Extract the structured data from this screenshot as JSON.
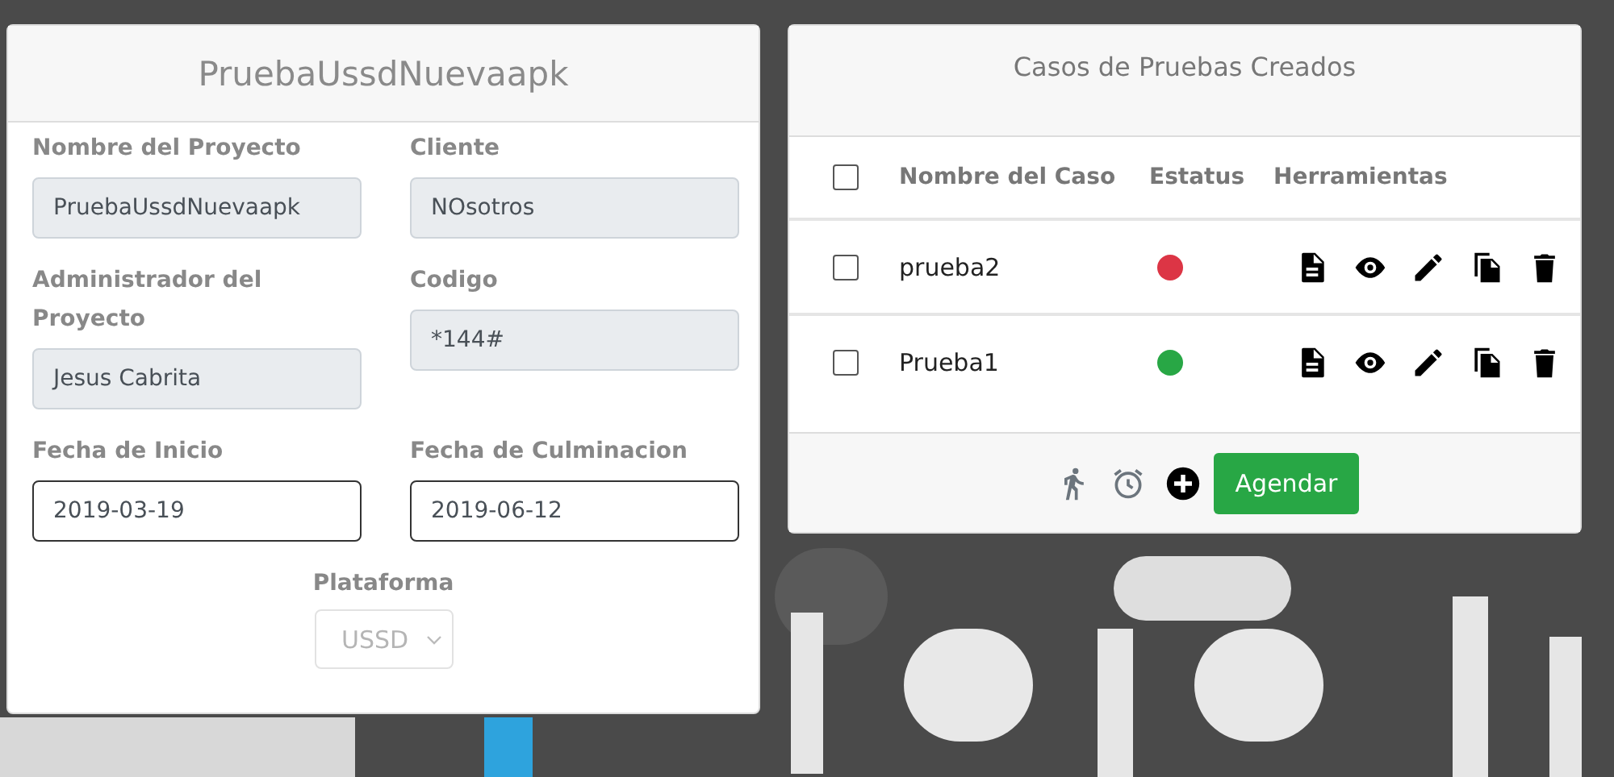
{
  "project_card": {
    "title": "PruebaUssdNuevaapk",
    "fields": [
      {
        "label": "Nombre del Proyecto",
        "value": "PruebaUssdNuevaapk",
        "readonly": true
      },
      {
        "label": "Cliente",
        "value": "NOsotros",
        "readonly": true
      },
      {
        "label": "Administrador del Proyecto",
        "value": "Jesus Cabrita",
        "readonly": true
      },
      {
        "label": "Codigo",
        "value": "*144#",
        "readonly": true
      },
      {
        "label": "Fecha de Inicio",
        "value": "2019-03-19",
        "readonly": false
      },
      {
        "label": "Fecha de Culminacion",
        "value": "2019-06-12",
        "readonly": false
      }
    ],
    "platform": {
      "label": "Plataforma",
      "value": "USSD",
      "disabled": true
    }
  },
  "cases_card": {
    "title": "Casos de Pruebas Creados",
    "table": {
      "select_all": {
        "checked": false
      },
      "columns": [
        "Nombre del Caso",
        "Estatus",
        "Herramientas"
      ],
      "rows": [
        {
          "checked": false,
          "name": "prueba2",
          "color": "#dc3545"
        },
        {
          "checked": false,
          "name": "Prueba1",
          "color": "#28a745"
        }
      ]
    },
    "footer": {
      "button": "Agendar"
    }
  }
}
